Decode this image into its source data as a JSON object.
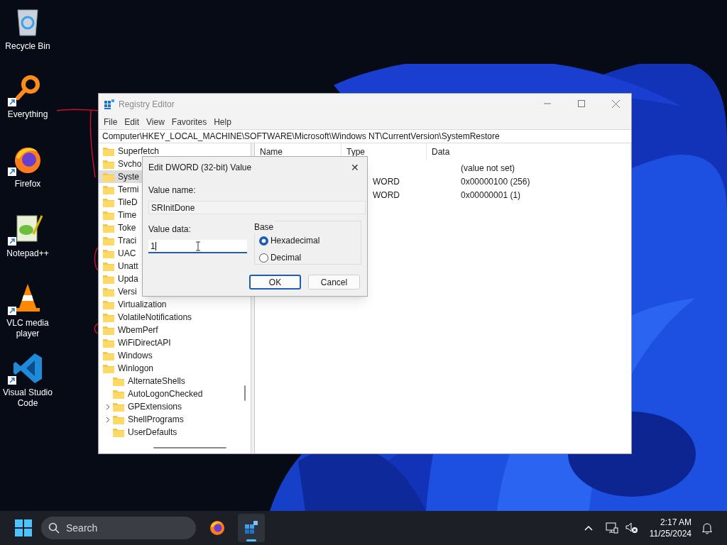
{
  "desktop_icons": [
    {
      "label": "Recycle Bin",
      "kind": "bin",
      "shortcut": false
    },
    {
      "label": "Everything",
      "kind": "ring",
      "shortcut": true
    },
    {
      "label": "Firefox",
      "kind": "fox",
      "shortcut": true
    },
    {
      "label": "Notepad++",
      "kind": "notepad",
      "shortcut": true
    },
    {
      "label": "VLC media player",
      "kind": "cone",
      "shortcut": true
    },
    {
      "label": "Visual Studio Code",
      "kind": "code",
      "shortcut": true
    }
  ],
  "window": {
    "title": "Registry Editor",
    "menu": [
      "File",
      "Edit",
      "View",
      "Favorites",
      "Help"
    ],
    "address": "Computer\\HKEY_LOCAL_MACHINE\\SOFTWARE\\Microsoft\\Windows NT\\CurrentVersion\\SystemRestore",
    "tree": [
      {
        "label": "Superfetch",
        "selected": false
      },
      {
        "label": "Svcho",
        "selected": false
      },
      {
        "label": "Syste",
        "selected": true
      },
      {
        "label": "Termi",
        "selected": false
      },
      {
        "label": "TileD",
        "selected": false
      },
      {
        "label": "Time",
        "selected": false
      },
      {
        "label": "Toke",
        "selected": false
      },
      {
        "label": "Traci",
        "selected": false
      },
      {
        "label": "UAC",
        "selected": false
      },
      {
        "label": "Unatt",
        "selected": false
      },
      {
        "label": "Upda",
        "selected": false
      },
      {
        "label": "Versi",
        "selected": false
      },
      {
        "label": "Virtualization",
        "selected": false
      },
      {
        "label": "VolatileNotifications",
        "selected": false
      },
      {
        "label": "WbemPerf",
        "selected": false
      },
      {
        "label": "WiFiDirectAPI",
        "selected": false
      },
      {
        "label": "Windows",
        "selected": false
      },
      {
        "label": "Winlogon",
        "selected": false,
        "children": [
          {
            "label": "AlternateShells",
            "selected": false,
            "expandable": false
          },
          {
            "label": "AutoLogonChecked",
            "selected": false,
            "expandable": false
          },
          {
            "label": "GPExtensions",
            "selected": false,
            "expandable": true
          },
          {
            "label": "ShellPrograms",
            "selected": false,
            "expandable": true
          },
          {
            "label": "UserDefaults",
            "selected": false,
            "expandable": false
          }
        ]
      }
    ],
    "columns": [
      "Name",
      "Type",
      "Data"
    ],
    "rows": [
      {
        "data": "(value not set)"
      },
      {
        "type": "WORD",
        "data": "0x00000100 (256)"
      },
      {
        "type": "WORD",
        "data": "0x00000001 (1)"
      }
    ]
  },
  "dialog": {
    "title": "Edit DWORD (32-bit) Value",
    "close": "✕",
    "value_name_label": "Value name:",
    "value_name": "SRInitDone",
    "value_data_label": "Value data:",
    "value_data": "1",
    "base_label": "Base",
    "bases": [
      {
        "label": "Hexadecimal",
        "selected": true
      },
      {
        "label": "Decimal",
        "selected": false
      }
    ],
    "buttons": [
      {
        "label": "OK",
        "default": true
      },
      {
        "label": "Cancel",
        "default": false
      }
    ]
  },
  "taskbar": {
    "search_placeholder": "Search",
    "apps": [
      {
        "kind": "fox",
        "active": false
      },
      {
        "kind": "registry",
        "active": true
      }
    ],
    "time": "2:17 AM",
    "date": "11/25/2024"
  }
}
